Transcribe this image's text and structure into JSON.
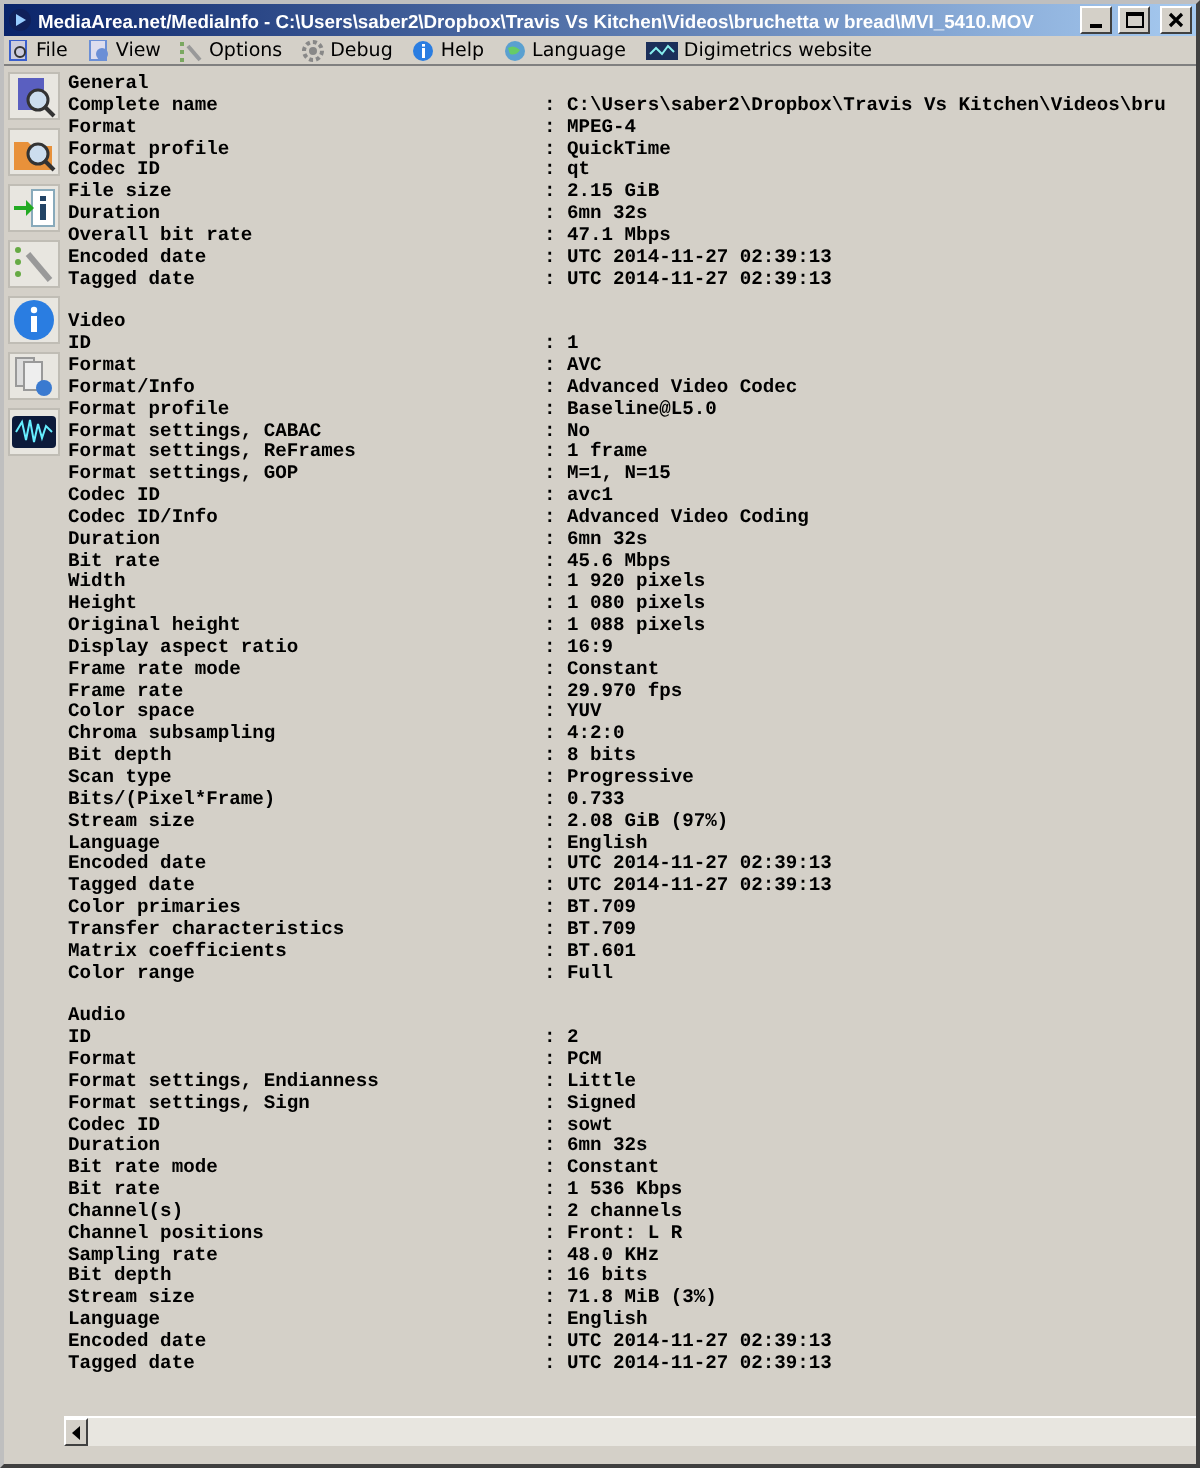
{
  "window": {
    "title": "MediaArea.net/MediaInfo - C:\\Users\\saber2\\Dropbox\\Travis Vs Kitchen\\Videos\\bruchetta w bread\\MVI_5410.MOV"
  },
  "menu": [
    {
      "label": "File",
      "kind": "file"
    },
    {
      "label": "View",
      "kind": "view"
    },
    {
      "label": "Options",
      "kind": "options"
    },
    {
      "label": "Debug",
      "kind": "debug"
    },
    {
      "label": "Help",
      "kind": "help"
    },
    {
      "label": "Language",
      "kind": "language"
    },
    {
      "label": "Digimetrics website",
      "kind": "web"
    }
  ],
  "toolbar": [
    {
      "kind": "open-file"
    },
    {
      "kind": "open-folder"
    },
    {
      "kind": "export"
    },
    {
      "kind": "preferences"
    },
    {
      "kind": "about"
    },
    {
      "kind": "knowledge"
    },
    {
      "kind": "website"
    }
  ],
  "sections": [
    {
      "title": "General",
      "rows": [
        {
          "label": "Complete name",
          "value": ": C:\\Users\\saber2\\Dropbox\\Travis Vs Kitchen\\Videos\\bru"
        },
        {
          "label": "Format",
          "value": ": MPEG-4"
        },
        {
          "label": "Format profile",
          "value": ": QuickTime"
        },
        {
          "label": "Codec ID",
          "value": ": qt"
        },
        {
          "label": "File size",
          "value": ": 2.15 GiB"
        },
        {
          "label": "Duration",
          "value": ": 6mn 32s"
        },
        {
          "label": "Overall bit rate",
          "value": ": 47.1 Mbps"
        },
        {
          "label": "Encoded date",
          "value": ": UTC 2014-11-27 02:39:13"
        },
        {
          "label": "Tagged date",
          "value": ": UTC 2014-11-27 02:39:13"
        }
      ]
    },
    {
      "title": "Video",
      "rows": [
        {
          "label": "ID",
          "value": ": 1"
        },
        {
          "label": "Format",
          "value": ": AVC"
        },
        {
          "label": "Format/Info",
          "value": ": Advanced Video Codec"
        },
        {
          "label": "Format profile",
          "value": ": Baseline@L5.0"
        },
        {
          "label": "Format settings, CABAC",
          "value": ": No"
        },
        {
          "label": "Format settings, ReFrames",
          "value": ": 1 frame"
        },
        {
          "label": "Format settings, GOP",
          "value": ": M=1, N=15"
        },
        {
          "label": "Codec ID",
          "value": ": avc1"
        },
        {
          "label": "Codec ID/Info",
          "value": ": Advanced Video Coding"
        },
        {
          "label": "Duration",
          "value": ": 6mn 32s"
        },
        {
          "label": "Bit rate",
          "value": ": 45.6 Mbps"
        },
        {
          "label": "Width",
          "value": ": 1 920 pixels"
        },
        {
          "label": "Height",
          "value": ": 1 080 pixels"
        },
        {
          "label": "Original height",
          "value": ": 1 088 pixels"
        },
        {
          "label": "Display aspect ratio",
          "value": ": 16:9"
        },
        {
          "label": "Frame rate mode",
          "value": ": Constant"
        },
        {
          "label": "Frame rate",
          "value": ": 29.970 fps"
        },
        {
          "label": "Color space",
          "value": ": YUV"
        },
        {
          "label": "Chroma subsampling",
          "value": ": 4:2:0"
        },
        {
          "label": "Bit depth",
          "value": ": 8 bits"
        },
        {
          "label": "Scan type",
          "value": ": Progressive"
        },
        {
          "label": "Bits/(Pixel*Frame)",
          "value": ": 0.733"
        },
        {
          "label": "Stream size",
          "value": ": 2.08 GiB (97%)"
        },
        {
          "label": "Language",
          "value": ": English"
        },
        {
          "label": "Encoded date",
          "value": ": UTC 2014-11-27 02:39:13"
        },
        {
          "label": "Tagged date",
          "value": ": UTC 2014-11-27 02:39:13"
        },
        {
          "label": "Color primaries",
          "value": ": BT.709"
        },
        {
          "label": "Transfer characteristics",
          "value": ": BT.709"
        },
        {
          "label": "Matrix coefficients",
          "value": ": BT.601"
        },
        {
          "label": "Color range",
          "value": ": Full"
        }
      ]
    },
    {
      "title": "Audio",
      "rows": [
        {
          "label": "ID",
          "value": ": 2"
        },
        {
          "label": "Format",
          "value": ": PCM"
        },
        {
          "label": "Format settings, Endianness",
          "value": ": Little"
        },
        {
          "label": "Format settings, Sign",
          "value": ": Signed"
        },
        {
          "label": "Codec ID",
          "value": ": sowt"
        },
        {
          "label": "Duration",
          "value": ": 6mn 32s"
        },
        {
          "label": "Bit rate mode",
          "value": ": Constant"
        },
        {
          "label": "Bit rate",
          "value": ": 1 536 Kbps"
        },
        {
          "label": "Channel(s)",
          "value": ": 2 channels"
        },
        {
          "label": "Channel positions",
          "value": ": Front: L R"
        },
        {
          "label": "Sampling rate",
          "value": ": 48.0 KHz"
        },
        {
          "label": "Bit depth",
          "value": ": 16 bits"
        },
        {
          "label": "Stream size",
          "value": ": 71.8 MiB (3%)"
        },
        {
          "label": "Language",
          "value": ": English"
        },
        {
          "label": "Encoded date",
          "value": ": UTC 2014-11-27 02:39:13"
        },
        {
          "label": "Tagged date",
          "value": ": UTC 2014-11-27 02:39:13"
        }
      ]
    }
  ]
}
